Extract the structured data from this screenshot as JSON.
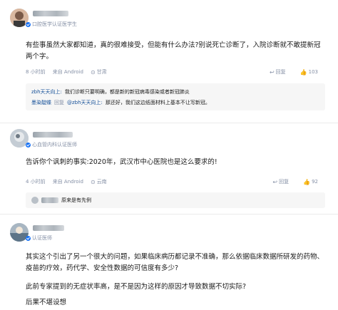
{
  "comments": [
    {
      "verify": "口腔医学认证医学生",
      "text": "有些事虽然大家都知道，真的很难接受，但能有什么办法?别说死亡诊断了，入院诊断就不敢提新冠两个字。",
      "time": "8 小时前",
      "source": "来自 Android",
      "location": "甘肃",
      "reply_label": "回复",
      "like_count": "103",
      "replies": [
        {
          "author": "zbh天天向上:",
          "text": "我们诊断只要明确，都是新的新冠病毒感染或者新冠肺炎"
        },
        {
          "author": "墨染靛蝶",
          "action": "回复",
          "target": "@zbh天天向上:",
          "text": "那还好，我们这边纸面材料上基本不让写新冠。"
        }
      ]
    },
    {
      "verify": "心血管内科认证医师",
      "text": "告诉你个讽刺的事实:2020年，武汉市中心医院也是这么要求的!",
      "time": "4 小时前",
      "source": "来自 Android",
      "location": "云南",
      "reply_label": "回复",
      "like_count": "92",
      "replies": [
        {
          "author": "",
          "text": "原来是有先例"
        }
      ]
    },
    {
      "verify": "认证医师",
      "paragraphs": [
        "其实这个引出了另一个很大的问题，如果临床病历都记录不准确，那么依据临床数据所研发的药物、疫苗的疗效，药代学、安全性数据的可信度有多少?",
        "此前专家提到的无症状率高，是不是因为这样的原因才导致数据不切实际?",
        "后果不堪设想"
      ]
    }
  ],
  "icons": {
    "reply": "reply-icon",
    "like": "thumb-up-icon",
    "dislike": "thumb-down-icon"
  }
}
